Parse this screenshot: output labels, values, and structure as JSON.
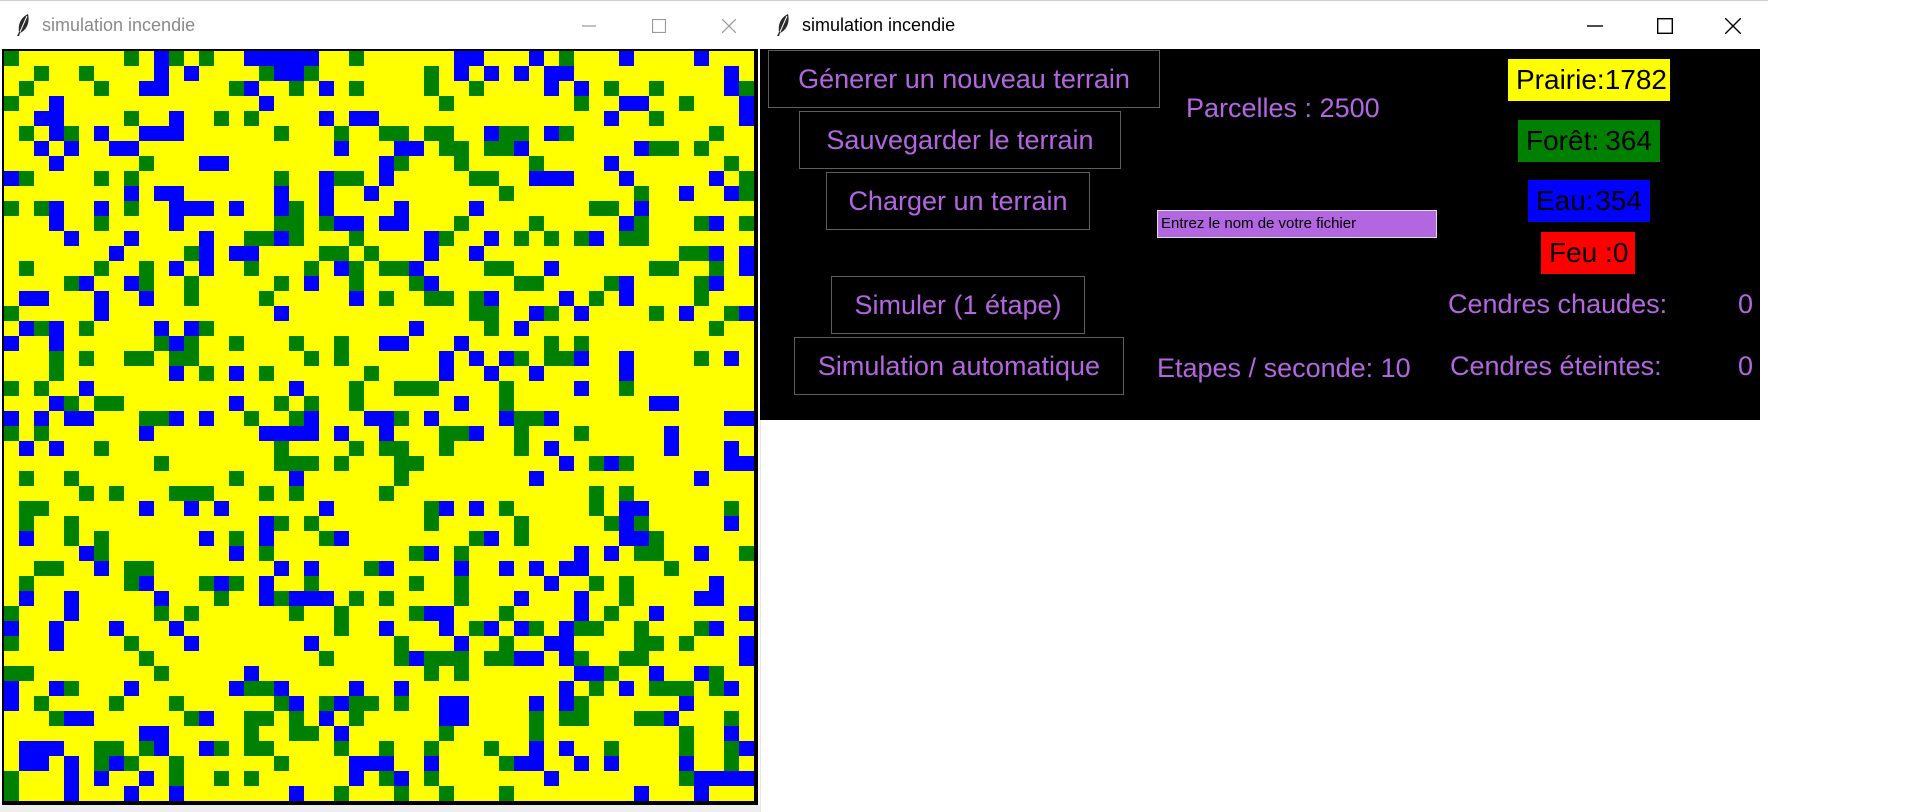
{
  "taskbar": {
    "accent_color": "#d84a4a"
  },
  "left_window": {
    "title": "simulation incendie",
    "grid": {
      "rows": 50,
      "cols": 50,
      "colors": {
        "prairie": "#ffff00",
        "foret": "#008000",
        "eau": "#0000ff"
      }
    }
  },
  "right_window": {
    "title": "simulation incendie",
    "buttons": {
      "generate": "Génerer un nouveau terrain",
      "save": "Sauvegarder le terrain",
      "load": "Charger un terrain",
      "step": "Simuler (1 étape)",
      "auto": "Simulation automatique"
    },
    "parcelles_label": "Parcelles : 2500",
    "filename_placeholder": "Entrez le nom de votre fichier",
    "steps_label": "Etapes / seconde: 10",
    "counts": {
      "prairie": {
        "label": "Prairie:",
        "value": "1782",
        "color": "#ffff00"
      },
      "foret": {
        "label": "Forêt:",
        "value": "364",
        "color": "#008000"
      },
      "eau": {
        "label": "Eau:",
        "value": "354",
        "color": "#0000ff"
      },
      "feu": {
        "label": "Feu :",
        "value": "0",
        "color": "#ff0000"
      }
    },
    "cendres_chaudes": {
      "label": "Cendres chaudes:",
      "value": "0"
    },
    "cendres_eteintes": {
      "label": "Cendres éteintes:",
      "value": "0"
    },
    "text_color": "#b266e0"
  }
}
